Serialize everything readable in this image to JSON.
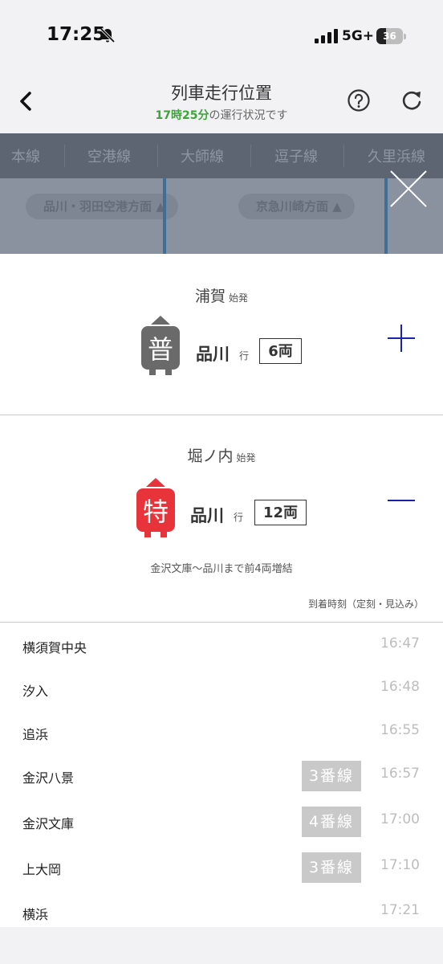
{
  "status_bar": {
    "time": "17:25",
    "network": "5G+",
    "battery_level": "36",
    "battery_fraction": 0.36
  },
  "header": {
    "title": "列車走行位置",
    "subtitle_time": "17時25分",
    "subtitle_rest": "の運行状況です"
  },
  "line_tabs": [
    "本線",
    "空港線",
    "大師線",
    "逗子線",
    "久里浜線"
  ],
  "directions": [
    "品川・羽田空港方面 ▲",
    "京急川崎方面 ▲"
  ],
  "trains": [
    {
      "origin": "浦賀",
      "origin_suffix": "始発",
      "type_char": "普",
      "type_color": "#6a6a6a",
      "destination": "品川",
      "destination_suffix": "行",
      "cars": "6両",
      "toggle": "plus"
    },
    {
      "origin": "堀ノ内",
      "origin_suffix": "始発",
      "type_char": "特",
      "type_color": "#e8333a",
      "destination": "品川",
      "destination_suffix": "行",
      "cars": "12両",
      "toggle": "minus",
      "note": "金沢文庫〜品川まで前4両増結",
      "arrival_header": "到着時刻（定刻・見込み）",
      "stops": [
        {
          "name": "横須賀中央",
          "time": "16:47",
          "platform": ""
        },
        {
          "name": "汐入",
          "time": "16:48",
          "platform": ""
        },
        {
          "name": "追浜",
          "time": "16:55",
          "platform": ""
        },
        {
          "name": "金沢八景",
          "time": "16:57",
          "platform": "3番線"
        },
        {
          "name": "金沢文庫",
          "time": "17:00",
          "platform": "4番線"
        },
        {
          "name": "上大岡",
          "time": "17:10",
          "platform": "3番線"
        },
        {
          "name": "横浜",
          "time": "17:21",
          "platform": ""
        }
      ]
    }
  ],
  "colors": {
    "accent_green": "#3ea33b",
    "toggle_blue": "#1a23a8",
    "map_overlay": "#8a929f"
  },
  "icons": [
    "bell-slash-icon",
    "signal-icon",
    "battery-icon",
    "chevron-left-icon",
    "help-icon",
    "refresh-icon",
    "close-icon",
    "plus-icon",
    "minus-icon"
  ]
}
